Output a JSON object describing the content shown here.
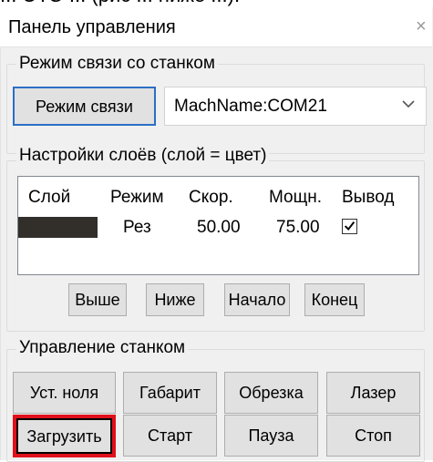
{
  "top_fragment": "... ЭТО ... (рис ... ниже ...).",
  "window": {
    "title": "Панель управления",
    "close_glyph": "×"
  },
  "connection": {
    "group_label": "Режим связи со станком",
    "mode_button": "Режим связи",
    "machine_select": "MachName:COM21"
  },
  "layers": {
    "group_label": "Настройки слоёв (слой = цвет)",
    "columns": [
      "Слой",
      "Режим",
      "Скор.",
      "Мощн.",
      "Вывод"
    ],
    "rows": [
      {
        "color": "#322e2a",
        "mode": "Рез",
        "speed": "50.00",
        "power": "75.00",
        "output_checked": true
      }
    ],
    "buttons": {
      "up": "Выше",
      "down": "Ниже",
      "first": "Начало",
      "last": "Конец"
    }
  },
  "machine_control": {
    "group_label": "Управление станком",
    "row1": [
      "Уст. ноля",
      "Габарит",
      "Обрезка",
      "Лазер"
    ],
    "row2": [
      "Загрузить",
      "Старт",
      "Пауза",
      "Стоп"
    ]
  },
  "colors": {
    "focus_border": "#2b6fc6",
    "highlight_outline": "#e0101c",
    "layer_swatch": "#322e2a"
  },
  "icons": [
    "close-icon",
    "chevron-down-icon",
    "checkmark-icon"
  ]
}
